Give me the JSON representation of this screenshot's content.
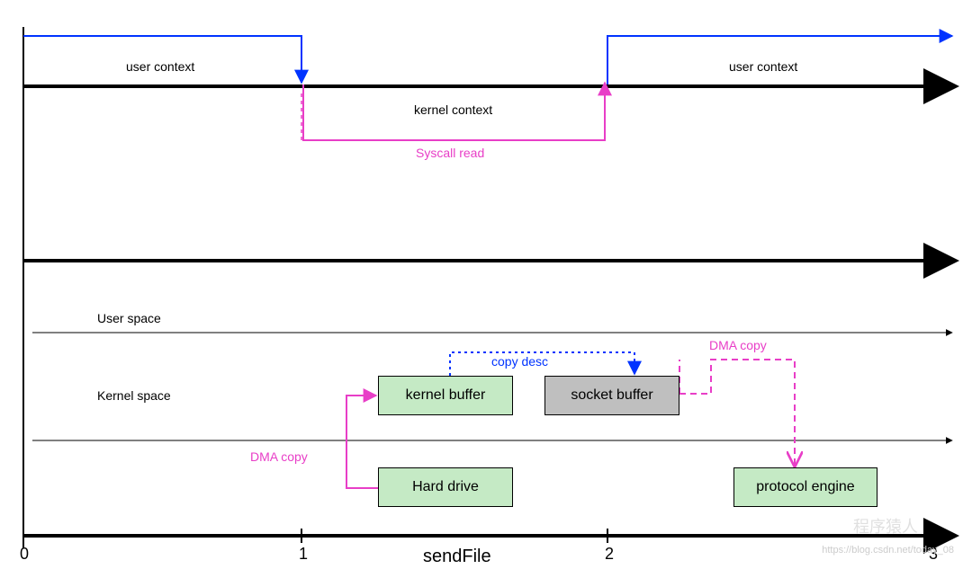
{
  "chart_data": {
    "type": "diagram",
    "title": "sendFile",
    "timeline_markers": [
      "0",
      "1",
      "2",
      "3"
    ],
    "labels": {
      "user_context_left": "user context",
      "user_context_right": "user context",
      "kernel_context": "kernel context",
      "syscall_read": "Syscall read",
      "user_space": "User space",
      "kernel_space": "Kernel  space",
      "dma_copy_left": "DMA copy",
      "dma_copy_right": "DMA copy",
      "copy_desc": "copy desc"
    },
    "boxes": {
      "kernel_buffer": "kernel buffer",
      "socket_buffer": "socket buffer",
      "hard_drive": "Hard drive",
      "protocol_engine": "protocol engine"
    },
    "flow": [
      {
        "from": "user context",
        "to": "kernel context",
        "at": 1,
        "type": "context-switch"
      },
      {
        "from": "kernel context",
        "to": "user context",
        "at": 2,
        "type": "context-switch"
      },
      {
        "from": "Hard drive",
        "to": "kernel buffer",
        "label": "DMA copy"
      },
      {
        "from": "kernel buffer",
        "to": "socket buffer",
        "label": "copy desc",
        "style": "dotted"
      },
      {
        "from": "socket buffer",
        "to": "protocol engine",
        "label": "DMA copy",
        "style": "dashed"
      }
    ]
  },
  "watermark": {
    "brand": "程序猿人",
    "url": "https://blog.csdn.net/today_08"
  }
}
